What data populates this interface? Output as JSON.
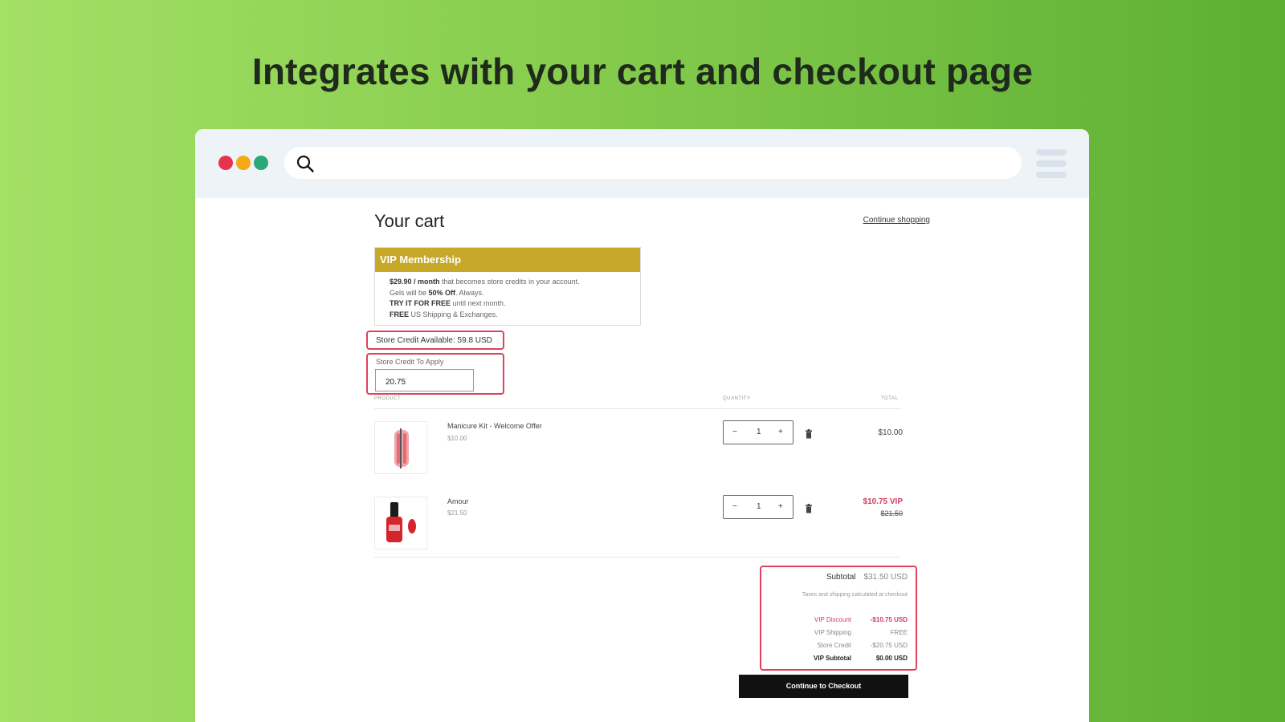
{
  "headline": "Integrates with your cart and checkout page",
  "browser": {
    "window_dots": [
      "red",
      "yellow",
      "green"
    ],
    "search_icon": "search-icon",
    "menu_icon": "hamburger-menu-icon"
  },
  "cart": {
    "title": "Your cart",
    "continue_shopping": "Continue shopping",
    "vip": {
      "header": "VIP Membership",
      "line1_bold": "$29.90 / month",
      "line1_rest": " that becomes store credits in your account.",
      "line2_pre": "Gels will be ",
      "line2_bold": "50% Off",
      "line2_rest": ". Always.",
      "line3_bold": "TRY IT FOR FREE",
      "line3_rest": " until next month.",
      "line4_bold": "FREE",
      "line4_rest": " US Shipping & Exchanges."
    },
    "store_credit_available": "Store Credit Available: 59.8 USD",
    "store_credit_apply_label": "Store Credit To Apply",
    "store_credit_apply_value": "20.75",
    "columns": {
      "product": "PRODUCT",
      "quantity": "QUANTITY",
      "total": "TOTAL"
    },
    "items": [
      {
        "name": "Manicure Kit - Welcome Offer",
        "price": "$10.00",
        "qty": "1",
        "total": "$10.00"
      },
      {
        "name": "Amour",
        "price": "$21.50",
        "qty": "1",
        "total_vip": "$10.75 VIP",
        "total_original": "$21.50"
      }
    ],
    "qty_minus": "−",
    "qty_plus": "+",
    "summary": {
      "subtotal_label": "Subtotal",
      "subtotal_value": "$31.50 USD",
      "tax_note": "Taxes and shipping calculated at checkout",
      "vip_discount_label": "VIP Discount",
      "vip_discount_value": "-$10.75 USD",
      "vip_shipping_label": "VIP Shipping",
      "vip_shipping_value": "FREE",
      "store_credit_label": "Store Credit",
      "store_credit_value": "-$20.75 USD",
      "vip_subtotal_label": "VIP Subtotal",
      "vip_subtotal_value": "$0.00 USD"
    },
    "checkout_button": "Continue to Checkout"
  },
  "colors": {
    "accent_red": "#e0415d",
    "vip_gold": "#c7a828",
    "vip_pink": "#d13c60",
    "checkout_black": "#111111"
  }
}
